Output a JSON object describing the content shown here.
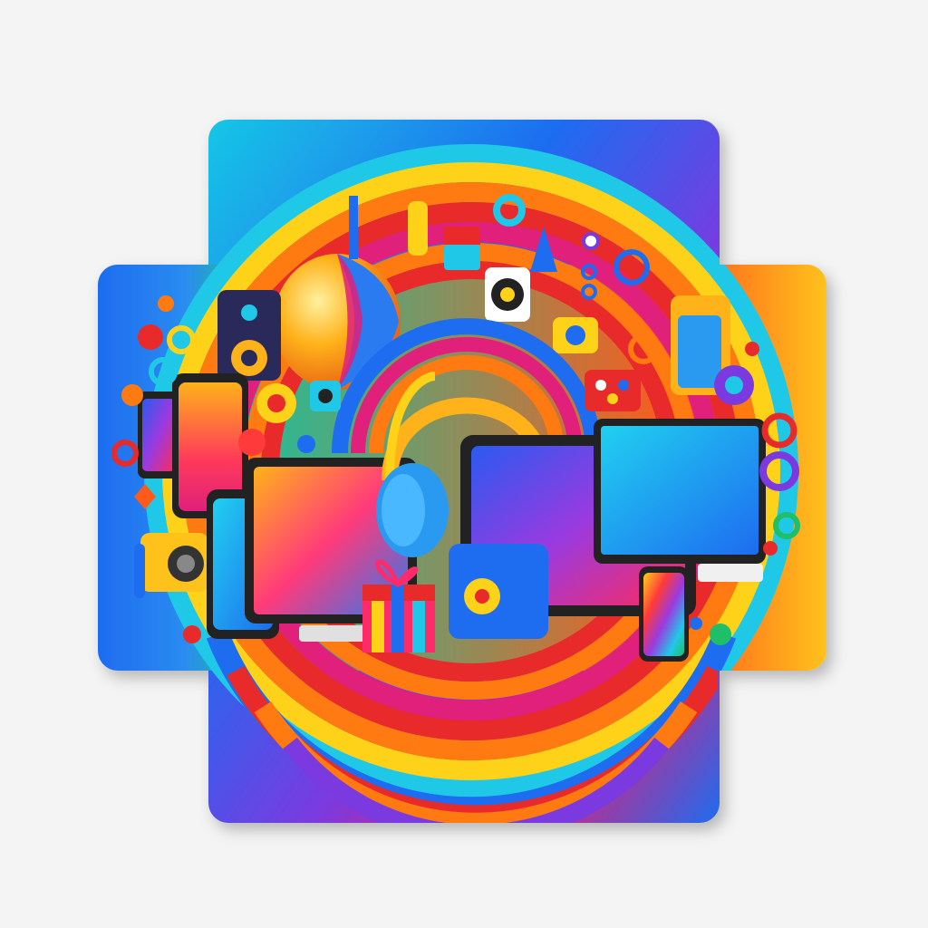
{
  "artwork": {
    "palette": {
      "background": "#f4f4f4",
      "blue": "#1e6cf0",
      "cyan": "#20c8e8",
      "magenta": "#e0207a",
      "purple": "#8a3ad8",
      "red": "#e82a2a",
      "orange": "#ff7a10",
      "yellow": "#ffd21a",
      "green": "#1fbf6a"
    },
    "objects": [
      "vertical-card",
      "horizontal-card",
      "rainbow-rings",
      "striped-balloon",
      "headphones",
      "laptop",
      "tablet",
      "monitor",
      "smartphones",
      "gift-box",
      "speaker",
      "camera",
      "decorative-rings"
    ]
  }
}
